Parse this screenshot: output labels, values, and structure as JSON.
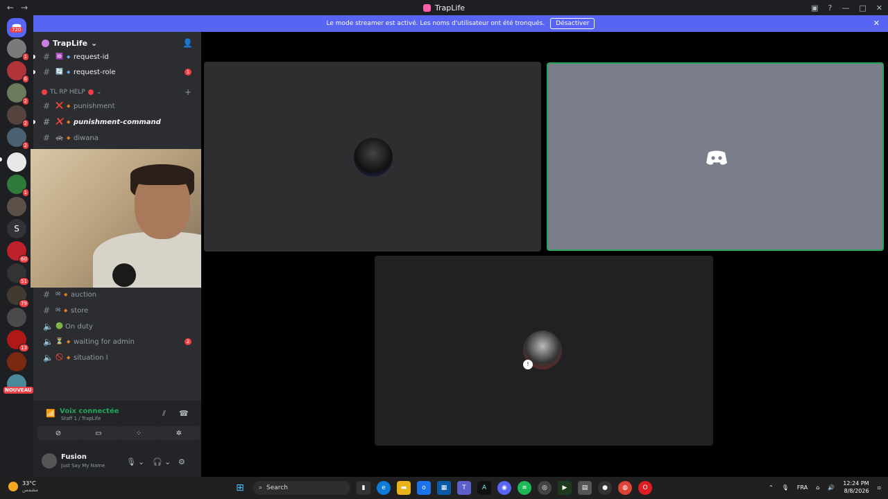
{
  "window": {
    "title": "TrapLife"
  },
  "banner": {
    "text": "Le mode streamer est activé. Les noms d'utilisateur ont été tronqués.",
    "button": "Désactiver"
  },
  "rail": {
    "home_badge": "720",
    "servers": [
      {
        "badge": "1"
      },
      {
        "badge": "6"
      },
      {
        "badge": "2"
      },
      {
        "badge": "2"
      },
      {
        "badge": "2"
      },
      {
        "badge": ""
      },
      {
        "badge": "1"
      },
      {
        "badge": ""
      },
      {
        "label": "S"
      },
      {
        "badge": "60"
      },
      {
        "badge": "51"
      },
      {
        "badge": "79"
      },
      {
        "badge": ""
      },
      {
        "badge": "13"
      },
      {
        "badge": ""
      },
      {
        "badge": ""
      }
    ],
    "new_label": "NOUVEAU"
  },
  "sidebar": {
    "server_name": "TrapLife",
    "category": "TL RP HELP",
    "channels": [
      {
        "name": "request-id",
        "emoji": "🆔",
        "count": ""
      },
      {
        "name": "request-role",
        "emoji": "🔄",
        "count": "1"
      },
      {
        "name": "punishment",
        "emoji": "❌",
        "count": ""
      },
      {
        "name": "punishment-command",
        "emoji": "❌",
        "count": ""
      },
      {
        "name": "diwana",
        "emoji": "🚓",
        "count": ""
      },
      {
        "name": "auction",
        "emoji": "✉",
        "count": ""
      },
      {
        "name": "store",
        "emoji": "✉",
        "count": ""
      },
      {
        "name": "On duty",
        "emoji": "🟢",
        "count": ""
      },
      {
        "name": "waiting for admin",
        "emoji": "⏳",
        "count": "2"
      },
      {
        "name": "situation l",
        "emoji": "🚫",
        "count": ""
      }
    ]
  },
  "voice": {
    "status": "Voix connectée",
    "channel": "Staff 1 / TrapLife"
  },
  "user": {
    "name": "Fusion",
    "status": "Just Say My Name"
  },
  "taskbar": {
    "temp": "33°C",
    "weather_sub": "مشمس",
    "search_placeholder": "Search",
    "lang": "FRA",
    "time": "12:24 PM",
    "date": "8/8/2026"
  },
  "colors": {
    "brand": "#5865f2",
    "speaking": "#23a55a",
    "badge": "#f23f43"
  }
}
